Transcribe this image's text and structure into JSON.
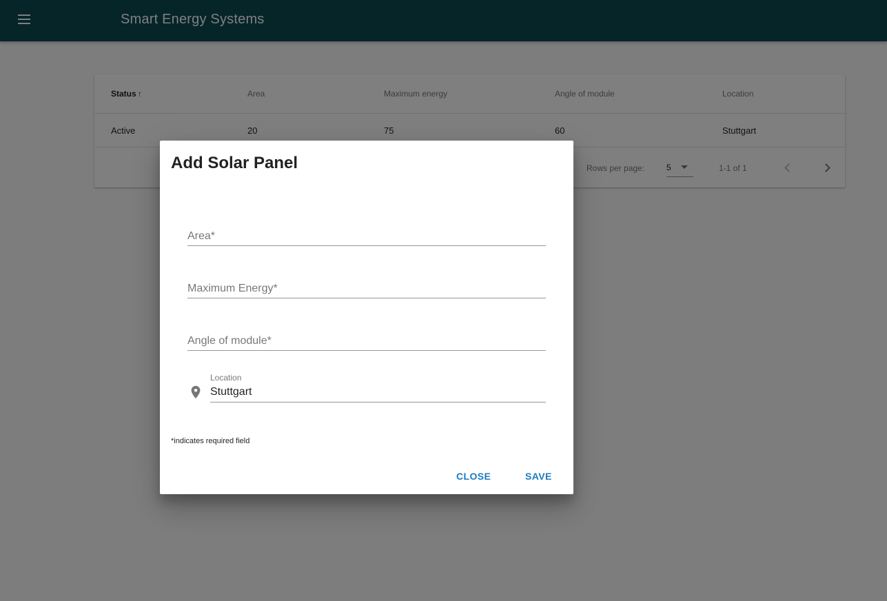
{
  "app": {
    "title": "Smart Energy Systems"
  },
  "table": {
    "columns": [
      "Status",
      "Area",
      "Maximum energy",
      "Angle of module",
      "Location"
    ],
    "sort_indicator": "↑",
    "rows": [
      [
        "Active",
        "20",
        "75",
        "60",
        "Stuttgart"
      ]
    ],
    "pagination": {
      "rows_per_page_label": "Rows per page:",
      "rows_per_page_value": "5",
      "range_label": "1-1 of 1"
    }
  },
  "dialog": {
    "title": "Add Solar Panel",
    "fields": {
      "area_label": "Area*",
      "max_energy_label": "Maximum Energy*",
      "angle_label": "Angle of module*",
      "location_label": "Location",
      "location_value": "Stuttgart"
    },
    "required_note": "*indicates required field",
    "close_label": "CLOSE",
    "save_label": "SAVE"
  },
  "colors": {
    "appbar": "#0b4a52",
    "accent": "#1b7bbf"
  },
  "icons": [
    "menu-icon",
    "arrow-up-icon",
    "caret-down-icon",
    "chevron-left-icon",
    "chevron-right-icon",
    "location-pin-icon"
  ]
}
